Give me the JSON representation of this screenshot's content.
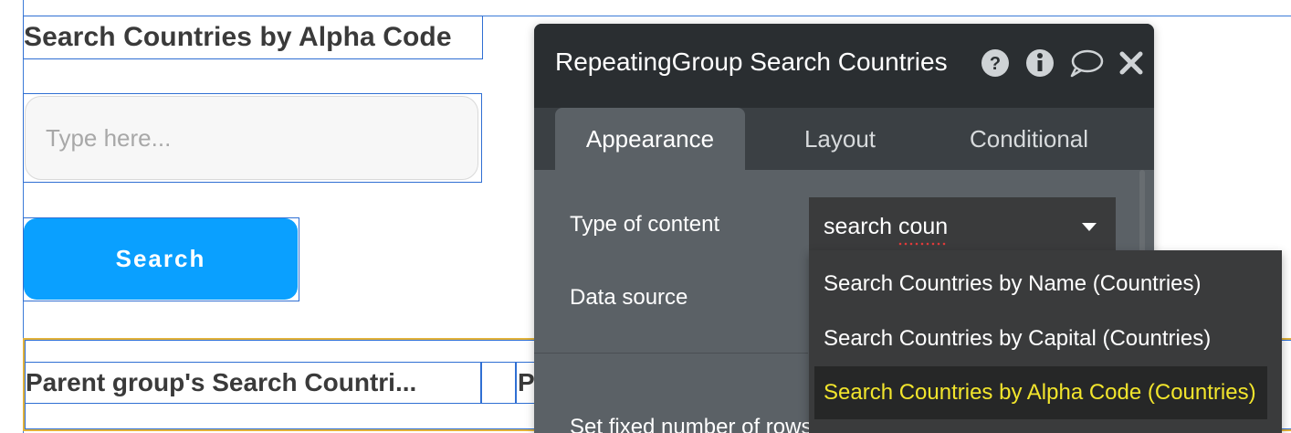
{
  "canvas": {
    "heading": "Search Countries by Alpha Code",
    "input": {
      "placeholder": "Type here...",
      "value": ""
    },
    "search_button": "Search",
    "repeating_group_cells": [
      "Parent group's Search Countri...",
      "P"
    ]
  },
  "panel": {
    "title": "RepeatingGroup Search Countries",
    "icons": [
      "help-icon",
      "info-icon",
      "comment-icon",
      "close-icon"
    ],
    "tabs": [
      {
        "label": "Appearance",
        "active": true
      },
      {
        "label": "Layout",
        "active": false
      },
      {
        "label": "Conditional",
        "active": false
      }
    ],
    "properties": {
      "type_of_content_label": "Type of content",
      "type_of_content_value_prefix": "search ",
      "type_of_content_value_misspelled": "coun",
      "data_source_label": "Data source",
      "fixed_rows_label": "Set fixed number of rows"
    },
    "dropdown_options": [
      {
        "label": "Search Countries by Name (Countries)",
        "selected": false
      },
      {
        "label": "Search Countries by Capital (Countries)",
        "selected": false
      },
      {
        "label": "Search Countries by Alpha Code (Countries)",
        "selected": true
      }
    ]
  },
  "colors": {
    "accent_button": "#0aa0ff",
    "selection_outline": "#2f6fd3",
    "group_outline": "#e2b23a",
    "panel_header": "#2a2e31",
    "panel_body": "#5b6166",
    "dropdown_highlight_text": "#f2e52c"
  }
}
